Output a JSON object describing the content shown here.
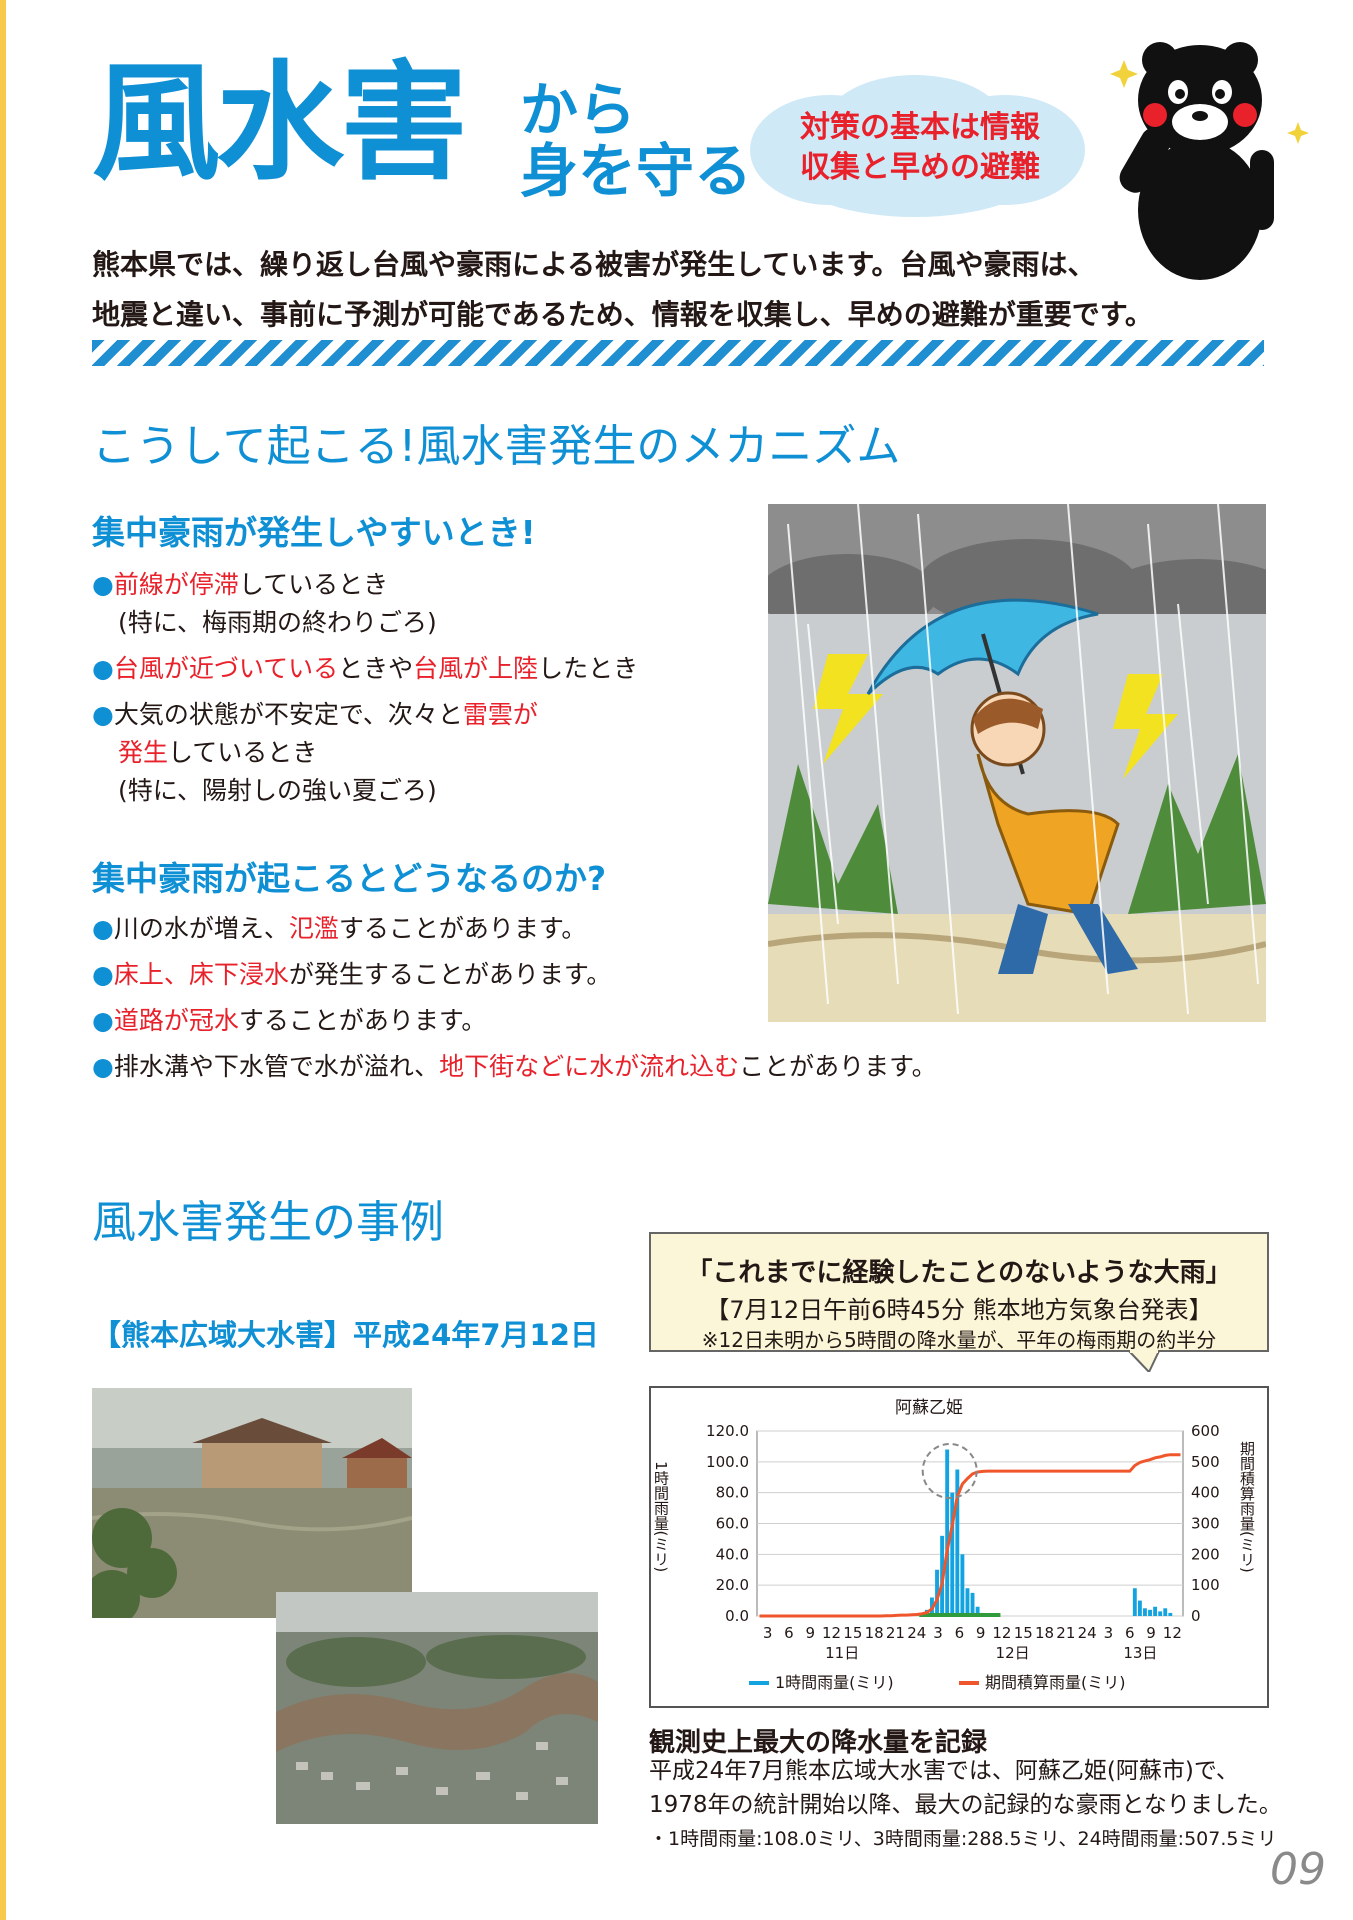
{
  "header": {
    "title_main": "風水害",
    "title_sub_line1": "から",
    "title_sub_line2": "身を守る",
    "cloud_line1": "対策の基本は情報",
    "cloud_line2": "収集と早めの避難",
    "intro_line1": "熊本県では、繰り返し台風や豪雨による被害が発生しています。台風や豪雨は、",
    "intro_line2": "地震と違い、事前に予測が可能であるため、情報を収集し、早めの避難が重要です。"
  },
  "mechanism": {
    "section_title": "こうして起こる!風水害発生のメカニズム",
    "when_heading": "集中豪雨が発生しやすいとき!",
    "when_items": [
      {
        "red": "前線が停滞",
        "rest": "しているとき"
      },
      {
        "note": "(特に、梅雨期の終わりごろ)"
      },
      {
        "red1": "台風が近づいている",
        "mid": "ときや",
        "red2": "台風が上陸",
        "end": "したとき"
      },
      {
        "pre": "大気の状態が不安定で、次々と",
        "red": "雷雲が"
      },
      {
        "red": "発生",
        "rest": "しているとき"
      },
      {
        "note": "(特に、陽射しの強い夏ごろ)"
      }
    ],
    "result_heading": "集中豪雨が起こるとどうなるのか?",
    "result_items": [
      {
        "pre": "川の水が増え、",
        "red": "氾濫",
        "rest": "することがあります。"
      },
      {
        "pre": "",
        "red": "床上、床下浸水",
        "rest": "が発生することがあります。"
      },
      {
        "pre": "",
        "red": "道路が冠水",
        "rest": "することがあります。"
      },
      {
        "pre": "排水溝や下水管で水が溢れ、",
        "red": "地下街などに水が流れ込む",
        "rest": "ことがあります。"
      }
    ]
  },
  "cases": {
    "section_title": "風水害発生の事例",
    "event_heading": "【熊本広域大水害】平成24年7月12日",
    "callout_line1": "「これまでに経験したことのないような大雨」",
    "callout_line2": "【7月12日午前6時45分 熊本地方気象台発表】",
    "callout_line3": "※12日未明から5時間の降水量が、平年の梅雨期の約半分",
    "obs_heading": "観測史上最大の降水量を記録",
    "obs_line1": "平成24年7月熊本広域大水害では、阿蘇乙姫(阿蘇市)で、",
    "obs_line2": "1978年の統計開始以降、最大の記録的な豪雨となりました。",
    "obs_line3": "・1時間雨量:108.0ミリ、3時間雨量:288.5ミリ、24時間雨量:507.5ミリ"
  },
  "chart_data": {
    "type": "bar",
    "title": "阿蘇乙姫",
    "ylabel": "1時間雨量(ミリ)",
    "y2label": "期間積算雨量(ミリ)",
    "ylim": [
      0,
      120
    ],
    "y2lim": [
      0,
      600
    ],
    "yticks": [
      "120.0",
      "100.0",
      "80.0",
      "60.0",
      "40.0",
      "20.0",
      "0.0"
    ],
    "y2ticks": [
      "600",
      "500",
      "400",
      "300",
      "200",
      "100",
      "0"
    ],
    "xticks": [
      "3",
      "6",
      "9",
      "12",
      "15",
      "18",
      "21",
      "24",
      "3",
      "6",
      "9",
      "12",
      "15",
      "18",
      "21",
      "24",
      "3",
      "6",
      "9",
      "12"
    ],
    "day_labels": [
      "11日",
      "12日",
      "13日"
    ],
    "legend": [
      "1時間雨量(ミリ)",
      "期間積算雨量(ミリ)"
    ],
    "series": [
      {
        "name": "1時間雨量(ミリ)",
        "values": [
          0,
          0,
          0,
          0,
          0,
          0,
          0,
          0,
          0,
          0,
          0,
          0,
          0,
          0,
          0,
          0,
          0,
          0,
          0,
          0,
          0,
          0,
          0,
          0,
          0,
          1,
          0,
          1,
          1,
          0,
          1,
          1,
          2,
          4,
          12,
          30,
          52,
          108,
          80,
          95,
          40,
          18,
          15,
          6,
          2,
          1,
          0,
          0,
          0,
          0,
          0,
          0,
          0,
          0,
          0,
          0,
          0,
          0,
          0,
          0,
          0,
          0,
          0,
          0,
          0,
          0,
          0,
          0,
          0,
          0,
          0,
          0,
          0,
          0,
          18,
          10,
          5,
          4,
          6,
          3,
          5,
          2,
          0,
          0
        ]
      },
      {
        "name": "期間積算雨量(ミリ)",
        "values": [
          0,
          0,
          0,
          0,
          0,
          0,
          0,
          0,
          0,
          0,
          0,
          0,
          0,
          0,
          0,
          0,
          0,
          0,
          0,
          0,
          0,
          0,
          0,
          0,
          0,
          1,
          1,
          2,
          3,
          3,
          4,
          5,
          7,
          11,
          23,
          53,
          105,
          213,
          293,
          388,
          428,
          446,
          461,
          467,
          469,
          470,
          470,
          470,
          470,
          470,
          470,
          470,
          470,
          470,
          470,
          470,
          470,
          470,
          470,
          470,
          470,
          470,
          470,
          470,
          470,
          470,
          470,
          470,
          470,
          470,
          470,
          470,
          470,
          470,
          488,
          498,
          503,
          507,
          513,
          516,
          521,
          523,
          523,
          523
        ]
      }
    ],
    "colors": {
      "bars": "#12a3e0",
      "line": "#f0562b",
      "highlight": "#2f9b3a"
    }
  },
  "page_number": "09",
  "colors": {
    "accent_blue": "#0f8fd4",
    "accent_red": "#e8212b"
  }
}
